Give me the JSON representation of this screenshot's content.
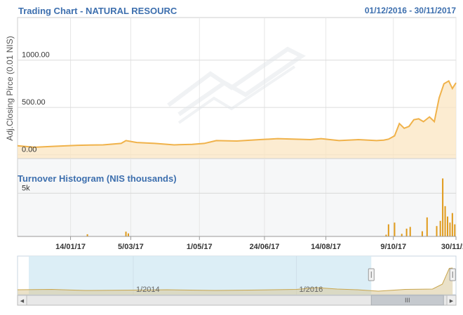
{
  "header": {
    "title": "Trading Chart - NATURAL RESOURC",
    "date_range": "01/12/2016 - 30/11/2017"
  },
  "chart_data": [
    {
      "type": "area",
      "ylabel": "Adj.Closing Pirce (0.01 NIS)",
      "y_ticks": [
        "0.00",
        "500.00",
        "1000.00"
      ],
      "y_tick_values": [
        0,
        500,
        1000
      ],
      "ylim": [
        -40,
        1450
      ],
      "x_ticks": [
        "14/01/17",
        "5/03/17",
        "1/05/17",
        "24/06/17",
        "14/08/17",
        "9/10/17",
        "30/11/17"
      ],
      "x_tick_values": [
        "2017-01-14",
        "2017-03-05",
        "2017-05-01",
        "2017-06-24",
        "2017-08-14",
        "2017-10-09",
        "2017-11-30"
      ],
      "xlim": [
        "2016-12-01",
        "2017-11-30"
      ],
      "color": "#f0b24a",
      "grid": true,
      "series": [
        {
          "x": [
            "2016-12-01",
            "2016-12-15",
            "2017-01-01",
            "2017-01-20",
            "2017-02-10",
            "2017-02-25",
            "2017-03-01",
            "2017-03-10",
            "2017-03-25",
            "2017-04-10",
            "2017-04-25",
            "2017-05-05",
            "2017-05-15",
            "2017-06-01",
            "2017-06-20",
            "2017-07-05",
            "2017-07-20",
            "2017-08-01",
            "2017-08-10",
            "2017-08-25",
            "2017-09-10",
            "2017-09-25",
            "2017-10-01",
            "2017-10-05",
            "2017-10-10",
            "2017-10-14",
            "2017-10-18",
            "2017-10-22",
            "2017-10-26",
            "2017-10-30",
            "2017-11-03",
            "2017-11-08",
            "2017-11-12",
            "2017-11-16",
            "2017-11-20",
            "2017-11-24",
            "2017-11-27",
            "2017-11-30"
          ],
          "y": [
            95,
            80,
            90,
            100,
            105,
            120,
            150,
            130,
            120,
            105,
            110,
            120,
            150,
            145,
            160,
            170,
            165,
            160,
            170,
            150,
            160,
            150,
            155,
            165,
            200,
            330,
            280,
            300,
            370,
            380,
            350,
            400,
            350,
            600,
            750,
            780,
            700,
            760
          ]
        }
      ]
    },
    {
      "type": "bar",
      "title": "Turnover Histogram (NIS thousands)",
      "y_ticks": [
        "5k"
      ],
      "y_tick_values": [
        5000
      ],
      "ylim": [
        0,
        9000
      ],
      "xlim": [
        "2016-12-01",
        "2017-11-30"
      ],
      "color": "#e09a1a",
      "series": [
        {
          "x": [
            "2017-01-28",
            "2017-03-01",
            "2017-03-03",
            "2017-10-03",
            "2017-10-05",
            "2017-10-10",
            "2017-10-16",
            "2017-10-20",
            "2017-10-23",
            "2017-11-02",
            "2017-11-06",
            "2017-11-14",
            "2017-11-17",
            "2017-11-19",
            "2017-11-21",
            "2017-11-23",
            "2017-11-25",
            "2017-11-27",
            "2017-11-29"
          ],
          "values": [
            250,
            550,
            350,
            200,
            1400,
            1600,
            300,
            900,
            1100,
            600,
            2200,
            1200,
            1800,
            6700,
            3500,
            2300,
            1600,
            2700,
            1400
          ]
        }
      ]
    },
    {
      "type": "area",
      "role": "navigator",
      "x_ticks": [
        "1/2014",
        "1/2016"
      ],
      "x_tick_values": [
        "2014-01-01",
        "2016-01-01"
      ],
      "xlim": [
        "2012-08-01",
        "2017-12-15"
      ],
      "selected_range": [
        "2016-12-01",
        "2017-11-30"
      ],
      "color": "#d8c89a",
      "series": [
        {
          "x": [
            "2012-08-01",
            "2013-01-01",
            "2013-06-01",
            "2014-01-01",
            "2014-06-01",
            "2015-01-01",
            "2015-06-01",
            "2016-01-01",
            "2016-04-01",
            "2016-07-01",
            "2016-10-01",
            "2017-01-01",
            "2017-05-01",
            "2017-09-01",
            "2017-10-15",
            "2017-11-15",
            "2017-11-30"
          ],
          "y": [
            140,
            150,
            120,
            130,
            140,
            120,
            130,
            150,
            200,
            160,
            140,
            100,
            150,
            160,
            300,
            750,
            760
          ]
        }
      ]
    }
  ],
  "navigator": {
    "scrollbar_grip": "III",
    "left_arrow": "◀",
    "right_arrow": "▶"
  }
}
